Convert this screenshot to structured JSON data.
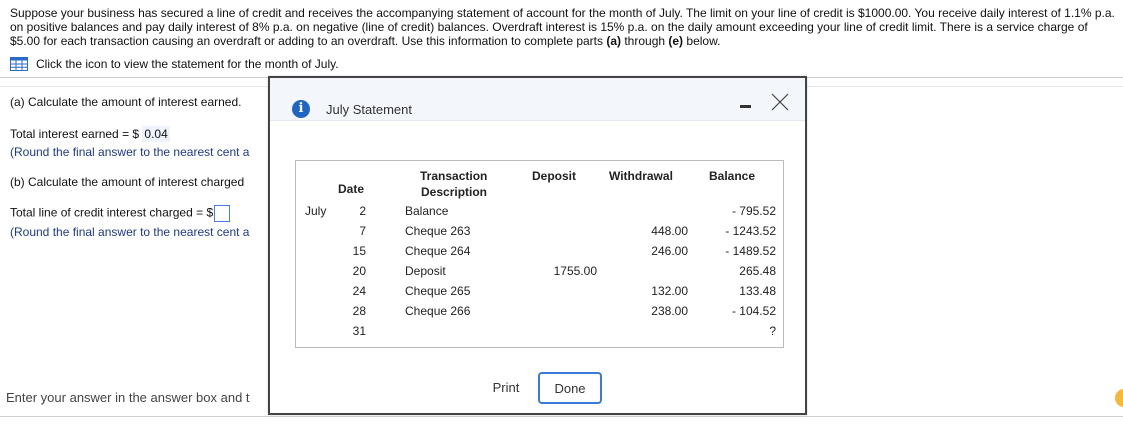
{
  "problem": {
    "text_before_a": "Suppose your business has secured a line of credit and receives the accompanying statement of account for the month of July. The limit on your line of credit is $1000.00. You receive daily interest of 1.1% p.a. on positive balances and pay daily interest of 8% p.a. on negative (line of credit) balances. Overdraft interest is 15% p.a. on the daily amount exceeding your line of credit limit. There is a service charge of $5.00 for each transaction causing an overdraft or adding to an overdraft. Use this information to complete parts ",
    "part_a": "(a)",
    "text_through": " through ",
    "part_e": "(e)",
    "text_end": " below."
  },
  "link": {
    "label": "Click the icon to view the statement for the month of July.",
    "icon": "table-icon"
  },
  "part_a": {
    "question": "(a) Calculate the amount of interest earned.",
    "answer_label": "Total interest earned = $ ",
    "answer_value": "0.04",
    "note": "(Round the final answer to the nearest cent a"
  },
  "part_b": {
    "question": "(b) Calculate the amount of interest charged",
    "answer_label": "Total line of credit interest charged = $",
    "answer_value": "",
    "note": "(Round the final answer to the nearest cent a"
  },
  "footer": {
    "text": "Enter your answer in the answer box and t"
  },
  "modal": {
    "title": "July Statement",
    "icon": "info-icon",
    "headers": {
      "date": "Date",
      "desc_line1": "Transaction",
      "desc_line2": "Description",
      "deposit": "Deposit",
      "withdrawal": "Withdrawal",
      "balance": "Balance"
    },
    "month": "July",
    "rows": [
      {
        "day": "2",
        "desc": "Balance",
        "deposit": "",
        "withdrawal": "",
        "balance": "- 795.52"
      },
      {
        "day": "7",
        "desc": "Cheque 263",
        "deposit": "",
        "withdrawal": "448.00",
        "balance": "- 1243.52"
      },
      {
        "day": "15",
        "desc": "Cheque 264",
        "deposit": "",
        "withdrawal": "246.00",
        "balance": "- 1489.52"
      },
      {
        "day": "20",
        "desc": "Deposit",
        "deposit": "1755.00",
        "withdrawal": "",
        "balance": "265.48"
      },
      {
        "day": "24",
        "desc": "Cheque 265",
        "deposit": "",
        "withdrawal": "132.00",
        "balance": "133.48"
      },
      {
        "day": "28",
        "desc": "Cheque 266",
        "deposit": "",
        "withdrawal": "238.00",
        "balance": "- 104.52"
      },
      {
        "day": "31",
        "desc": "",
        "deposit": "",
        "withdrawal": "",
        "balance": "?"
      }
    ],
    "print_label": "Print",
    "done_label": "Done"
  },
  "colors": {
    "accent": "#3b7bd6",
    "info": "#1f66c4",
    "help": "#f3b83d"
  }
}
